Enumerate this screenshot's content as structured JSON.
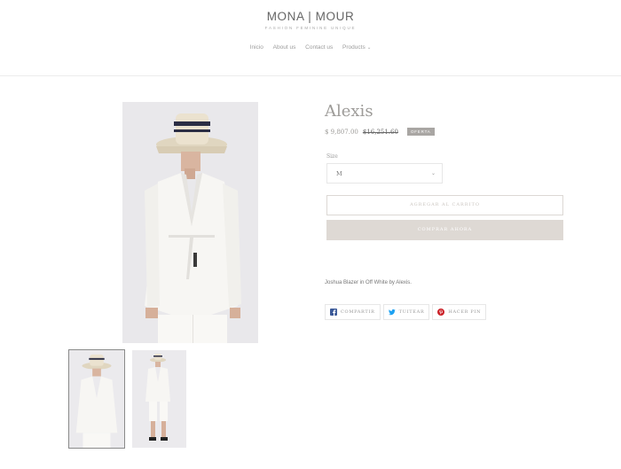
{
  "header": {
    "logo_main": "MONA | MOUR",
    "logo_sub": "FASHION   FEMININE   UNIQUE",
    "nav": [
      {
        "label": "Inicio"
      },
      {
        "label": "About us"
      },
      {
        "label": "Contact us"
      },
      {
        "label": "Products"
      }
    ]
  },
  "product": {
    "title": "Alexis",
    "price": "$ 9,807.00",
    "compare_price": "$16,251.60",
    "badge": "OFERTA",
    "size_label": "Size",
    "size_value": "M",
    "add_to_cart": "AGREGAR AL CARRITO",
    "buy_now": "COMPRAR AHORA",
    "description": "Joshua Blazer in Off White by Alexis."
  },
  "share": {
    "facebook": "COMPARTIR",
    "twitter": "TUITEAR",
    "pinterest": "HACER PIN"
  },
  "icons": {
    "facebook": "facebook-icon",
    "twitter": "twitter-icon",
    "pinterest": "pinterest-icon",
    "chevron": "chevron-down-icon"
  },
  "colors": {
    "facebook": "#3b5998",
    "twitter": "#1da1f2",
    "pinterest": "#cb2027",
    "button": "#ded9d4",
    "badge": "#a9a6a3"
  }
}
